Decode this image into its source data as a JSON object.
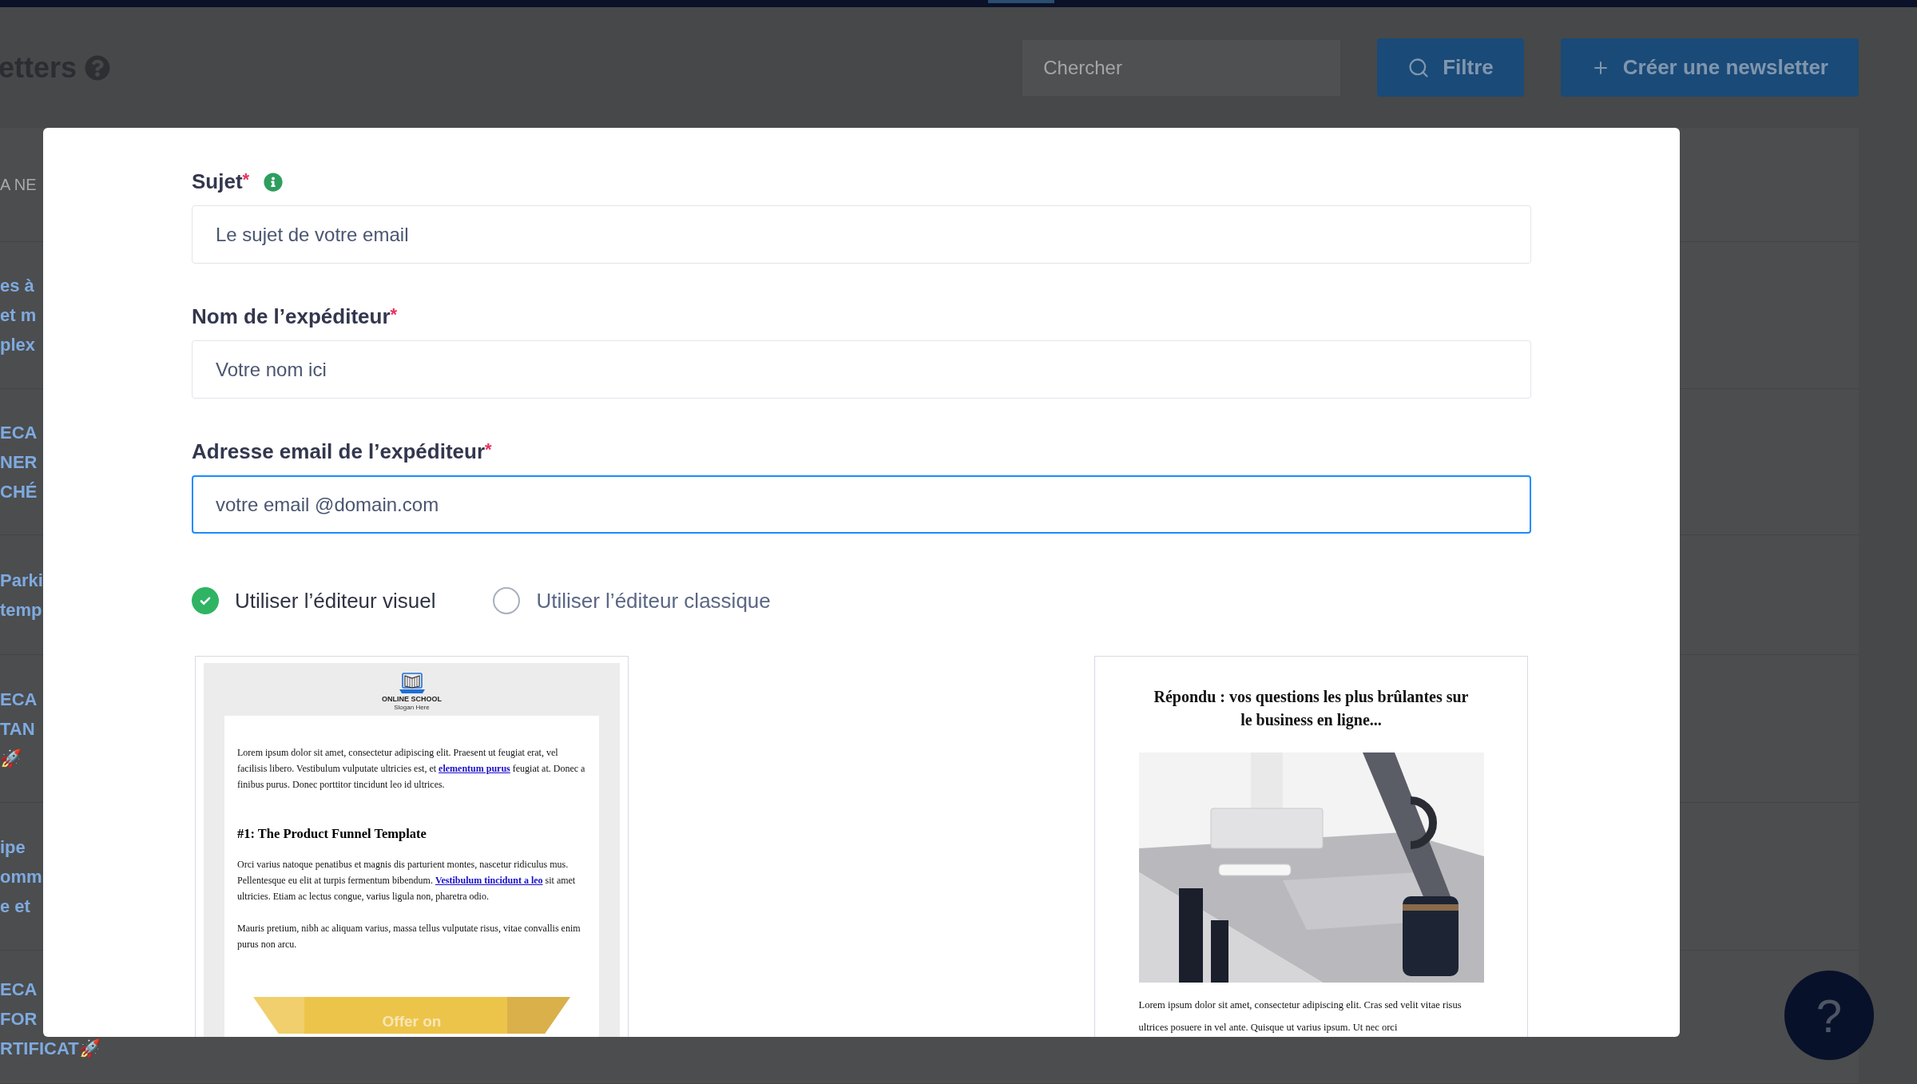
{
  "header": {
    "title": "etters",
    "search": {
      "placeholder": "Chercher"
    },
    "filter_button": "Filtre",
    "create_button": "Créer une newsletter"
  },
  "list": {
    "column_header": "A NE",
    "rows": [
      {
        "lines": [
          "es à",
          "et m",
          "plex"
        ]
      },
      {
        "lines": [
          "ECA",
          "NER",
          "CHÉ"
        ]
      },
      {
        "lines": [
          "Parki",
          "temp"
        ]
      },
      {
        "lines": [
          "ECA",
          "TAN",
          "🚀"
        ]
      },
      {
        "lines": [
          "ipe",
          "omm",
          "e et"
        ]
      },
      {
        "lines": [
          "ECA",
          "FOR",
          "RTIFICAT🚀"
        ]
      }
    ]
  },
  "modal": {
    "fields": [
      {
        "label": "Sujet",
        "required_mark": "*",
        "info": true,
        "value": "Le sujet de votre email",
        "focused": false
      },
      {
        "label": "Nom de l’expéditeur",
        "required_mark": "*",
        "info": false,
        "value": "Votre nom ici",
        "focused": false
      },
      {
        "label": "Adresse email de l’expéditeur",
        "required_mark": "*",
        "info": false,
        "value": "votre email @domain.com",
        "focused": true
      }
    ],
    "editor_options": [
      {
        "label": "Utiliser l’éditeur visuel",
        "selected": true
      },
      {
        "label": "Utiliser l’éditeur classique",
        "selected": false
      }
    ],
    "templates": [
      {
        "kind": "newsletter",
        "logo_name": "ONLINE SCHOOL",
        "logo_slogan": "Slogan Here",
        "blocks": [
          {
            "kind": "paragraph",
            "parts": [
              {
                "text": "Lorem ipsum dolor sit amet, consectetur adipiscing elit. Praesent ut feugiat erat, vel facilisis libero. Vestibulum vulputate ultricies est, et ",
                "link": false
              },
              {
                "text": "elementum purus",
                "link": true
              },
              {
                "text": " feugiat at. Donec a finibus purus. Donec porttitor tincidunt leo id ultrices.",
                "link": false
              }
            ]
          },
          {
            "kind": "heading",
            "text": "#1: The Product Funnel Template"
          },
          {
            "kind": "paragraph",
            "parts": [
              {
                "text": "Orci varius natoque penatibus et magnis dis parturient montes, nascetur ridiculus mus. Pellentesque eu elit at turpis fermentum bibendum. ",
                "link": false
              },
              {
                "text": "Vestibulum tincidunt a leo",
                "link": true
              },
              {
                "text": " sit amet ultricies. Etiam ac lectus congue, varius ligula non, pharetra odio.",
                "link": false
              }
            ]
          },
          {
            "kind": "paragraph",
            "parts": [
              {
                "text": "Mauris pretium, nibh ac aliquam varius, massa tellus vulputate risus, vitae convallis enim purus non arcu.",
                "link": false
              }
            ]
          }
        ],
        "banner": "Offer on"
      },
      {
        "kind": "article",
        "heading": "Répondu : vos questions les plus brûlantes sur le business en ligne...",
        "body": "Lorem ipsum dolor sit amet, consectetur adipiscing elit. Cras sed velit vitae risus ultrices posuere in vel ante. Quisque ut varius ipsum. Ut nec orci"
      }
    ]
  },
  "help_button": "?"
}
